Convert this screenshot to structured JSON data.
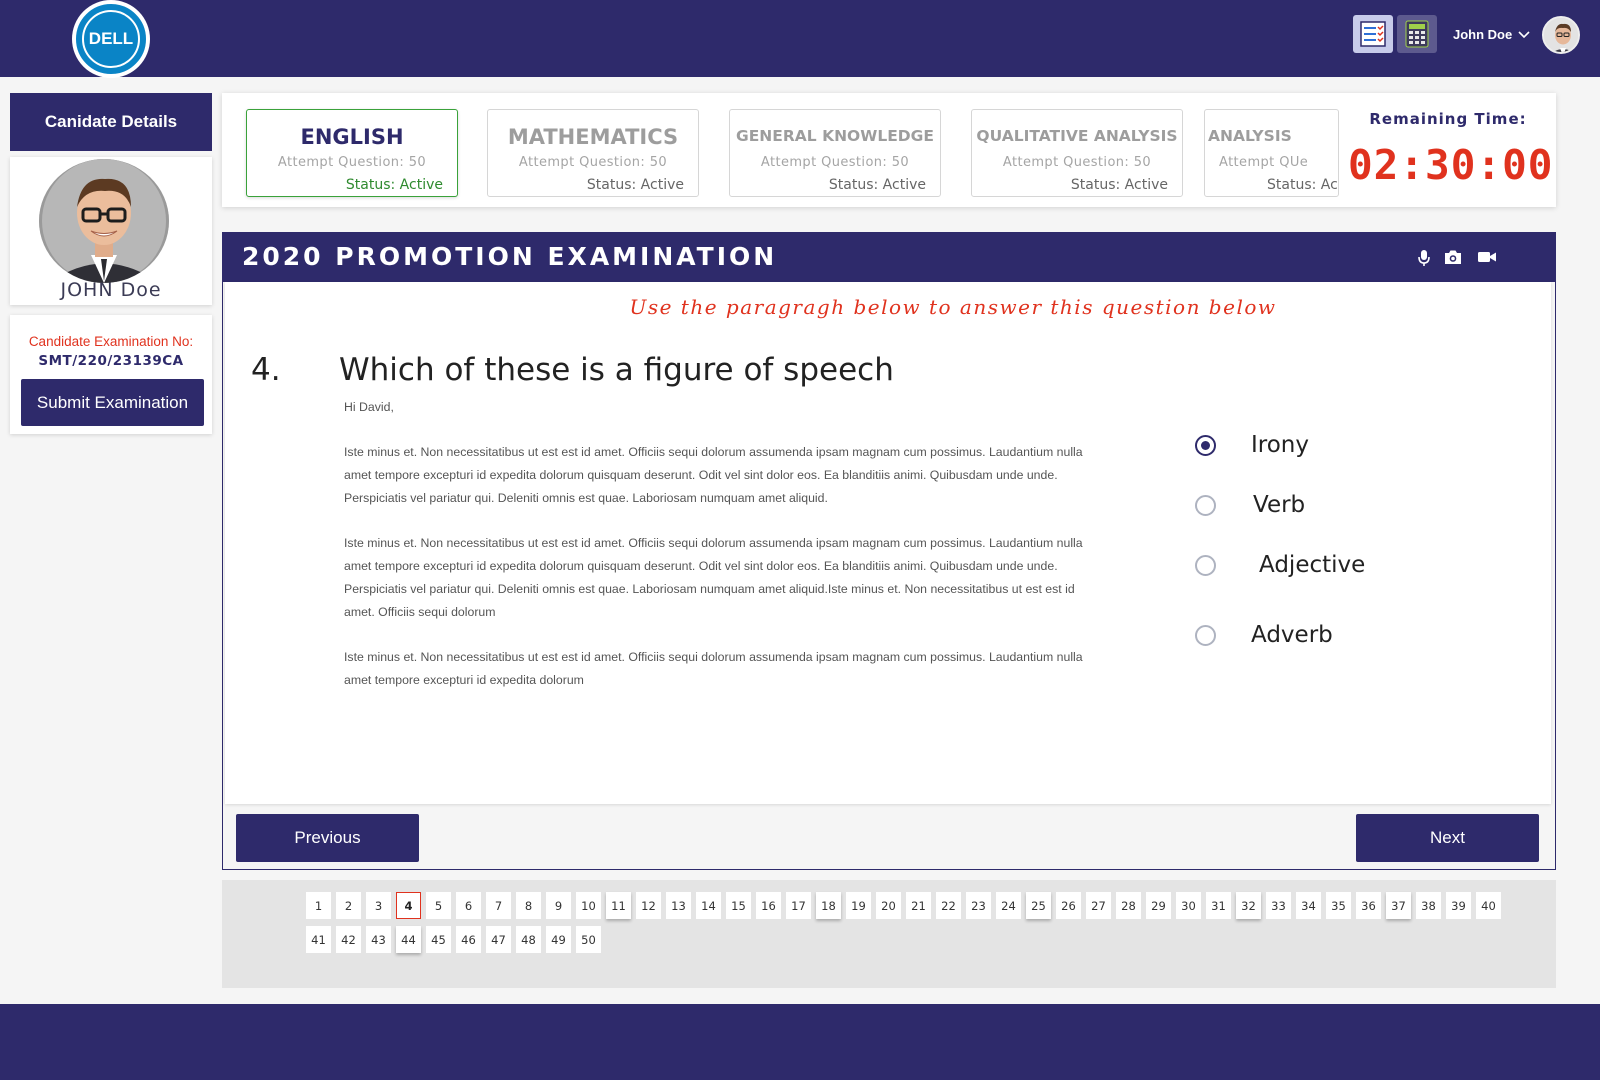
{
  "header": {
    "logo_text": "DELL",
    "user_name": "John Doe",
    "icons": [
      "checklist-icon",
      "calculator-icon",
      "chevron-down-icon",
      "avatar"
    ]
  },
  "candidate": {
    "header_label": "Canidate Details",
    "name": "JOHN Doe",
    "exam_no_label": "Candidate Examination No:",
    "exam_no": "SMT/220/23139CA",
    "submit_label": "Submit Examination"
  },
  "subjects": [
    {
      "name": "ENGLISH",
      "attempt": "Attempt Question: 50",
      "status": "Status: Active",
      "active": true
    },
    {
      "name": "MATHEMATICS",
      "attempt": "Attempt Question: 50",
      "status": "Status: Active",
      "active": false
    },
    {
      "name": "GENERAL KNOWLEDGE",
      "attempt": "Attempt Question: 50",
      "status": "Status: Active",
      "active": false
    },
    {
      "name": "QUALITATIVE ANALYSIS",
      "attempt": "Attempt Question: 50",
      "status": "Status: Active",
      "active": false
    },
    {
      "name": "ANALYSIS",
      "attempt": "Attempt QUe",
      "status": "Status: Act",
      "active": false
    }
  ],
  "timer": {
    "label": "Remaining Time:",
    "value": "02:30:00"
  },
  "exam": {
    "title": "2020 PROMOTION EXAMINATION",
    "header_icons": [
      "microphone-icon",
      "camera-icon",
      "video-icon"
    ],
    "instruction": "Use the paragragh below to answer this question below",
    "question_number": "4.",
    "question_text": "Which of these is a figure of speech",
    "greeting": "Hi David,",
    "paragraphs": [
      "Iste minus et. Non necessitatibus ut est est id amet. Officiis sequi dolorum assumenda ipsam magnam cum possimus. Laudantium nulla amet tempore excepturi id expedita dolorum quisquam deserunt. Odit vel sint dolor eos. Ea blanditiis animi. Quibusdam unde unde. Perspiciatis vel pariatur qui. Deleniti omnis est quae. Laboriosam numquam amet aliquid.",
      "Iste minus et. Non necessitatibus ut est est id amet. Officiis sequi dolorum assumenda ipsam magnam cum possimus. Laudantium nulla amet tempore excepturi id expedita dolorum quisquam deserunt. Odit vel sint dolor eos. Ea blanditiis animi. Quibusdam unde unde. Perspiciatis vel pariatur qui. Deleniti omnis est quae. Laboriosam numquam amet aliquid.Iste minus et. Non necessitatibus ut est est id amet. Officiis sequi dolorum",
      "Iste minus et. Non necessitatibus ut est est id amet. Officiis sequi dolorum assumenda ipsam magnam cum possimus. Laudantium nulla amet tempore excepturi id expedita dolorum"
    ],
    "options": [
      {
        "label": "Irony",
        "checked": true
      },
      {
        "label": "Verb",
        "checked": false
      },
      {
        "label": "Adjective",
        "checked": false
      },
      {
        "label": "Adverb",
        "checked": false
      }
    ],
    "previous_label": "Previous",
    "next_label": "Next"
  },
  "question_grid": {
    "total": 50,
    "current": 4,
    "labels": [
      "1",
      "2",
      "3",
      "4",
      "5",
      "6",
      "7",
      "8",
      "9",
      "10",
      "11",
      "12",
      "13",
      "14",
      "15",
      "16",
      "17",
      "18",
      "19",
      "20",
      "21",
      "22",
      "23",
      "24",
      "25",
      "26",
      "27",
      "28",
      "29",
      "30",
      "31",
      "32",
      "33",
      "34",
      "35",
      "36",
      "37",
      "38",
      "39",
      "40",
      "41",
      "42",
      "43",
      "44",
      "45",
      "46",
      "47",
      "48",
      "49",
      "50"
    ],
    "shadowed": [
      11,
      18,
      25,
      32,
      37,
      44
    ]
  },
  "colors": {
    "primary": "#2e2a6b",
    "accent_red": "#e0321e",
    "active_green": "#3aa23a",
    "dell_blue": "#0a84c6"
  }
}
